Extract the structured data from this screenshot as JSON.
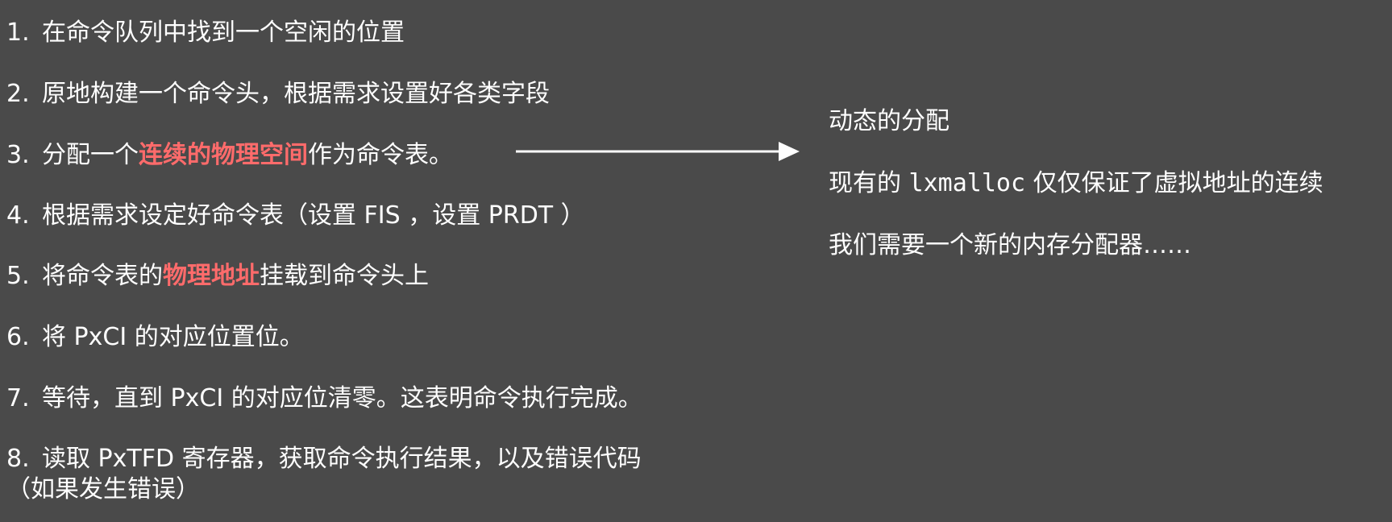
{
  "steps": [
    {
      "num": "1.",
      "text": "在命令队列中找到一个空闲的位置"
    },
    {
      "num": "2.",
      "text": "原地构建一个命令头，根据需求设置好各类字段"
    },
    {
      "num": "3.",
      "pre": "分配一个",
      "highlight": "连续的物理空间",
      "post": "作为命令表。"
    },
    {
      "num": "4.",
      "text": "根据需求设定好命令表（设置 FIS ，设置 PRDT ）"
    },
    {
      "num": "5.",
      "pre": "将命令表的",
      "highlight": "物理地址",
      "post": "挂载到命令头上"
    },
    {
      "num": "6.",
      "text": "将 PxCI 的对应位置位。"
    },
    {
      "num": "7.",
      "text": "等待，直到 PxCI 的对应位清零。这表明命令执行完成。"
    },
    {
      "num": "8.",
      "text": "读取 PxTFD 寄存器，获取命令执行结果，以及错误代码",
      "continuation": "（如果发生错误）"
    }
  ],
  "notes": {
    "line1": "动态的分配",
    "line2_pre": "现有的 ",
    "line2_code": "lxmalloc",
    "line2_post": " 仅仅保证了虚拟地址的连续",
    "line3": "我们需要一个新的内存分配器……"
  },
  "colors": {
    "background": "#4a4a4a",
    "text": "#ffffff",
    "highlight": "#ff6b6b"
  }
}
